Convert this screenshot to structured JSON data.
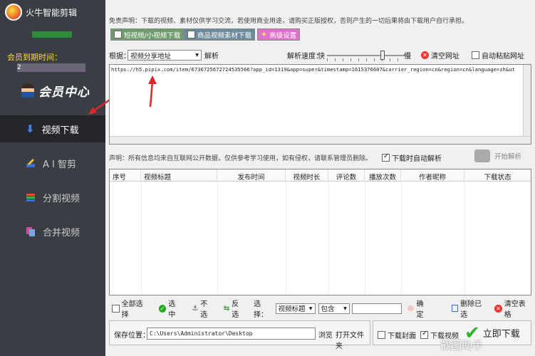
{
  "app": {
    "title": "火牛智能剪辑"
  },
  "sidebar": {
    "member_expiry_label": "会员到期时间：",
    "member_expiry_prefix": "2",
    "member_center_label": "会员中心",
    "items": [
      {
        "label": "视频下载",
        "icon": "arrow-down-icon",
        "active": true
      },
      {
        "label": "A I 智剪",
        "icon": "ai-edit-icon",
        "active": false
      },
      {
        "label": "分割视频",
        "icon": "split-icon",
        "active": false
      },
      {
        "label": "合并视频",
        "icon": "merge-icon",
        "active": false
      }
    ]
  },
  "notice": "免责声明：下载的视频、素材仅供学习交流，若使用商业用途，请购买正版授权，否则产生的一切后果将由下载用户自行承担。",
  "toolbar": {
    "buttons": [
      {
        "label": "短视频/小视频下载",
        "color": "#5f8f5f"
      },
      {
        "label": "商品视频素材下载",
        "color": "#5f7f8f"
      },
      {
        "label": "高级设置",
        "color": "#e26cc8"
      }
    ]
  },
  "parse_row": {
    "by_label": "根据：",
    "source_select": "视频分享地址",
    "parse_label": "解析",
    "speed_label": "解析速度：",
    "fast_label": "快",
    "slow_label": "慢",
    "clear_url_label": "清空网址",
    "auto_paste_label": "自动粘贴网址",
    "auto_paste_checked": false
  },
  "url_input": {
    "value": "https://h5.pipix.com/item/6736725672724535566?app_id=1319&app=super&timestamp=1615376607&carrier_region=cn&region=cn&language=zh&ut"
  },
  "statement": "声明：所有信息均来自互联网公开数据，仅供参考学习使用，如有侵权，请联系管理员删除。",
  "auto_parse": {
    "label": "下载时自动解析",
    "checked": true
  },
  "start_parse_label": "开始解析",
  "table": {
    "headers": [
      "序号",
      "视频标题",
      "发布时间",
      "视频时长",
      "评论数",
      "播放次数",
      "作者昵称",
      "下载状态"
    ],
    "rows": []
  },
  "bottom": {
    "select_all": "全部选择",
    "select": "选中",
    "deselect": "不选",
    "invert": "反选",
    "select_label": "选择：",
    "field_select": "视频标题",
    "match_select": "包含",
    "filter_value": "",
    "confirm": "确定",
    "delete_selected": "删除已选",
    "clear_table": "清空表格"
  },
  "save": {
    "label": "保存位置：",
    "path": "C:\\Users\\Administrator\\Desktop",
    "browse": "浏览",
    "open_folder": "打开文件夹"
  },
  "download": {
    "cover_label": "下载封面",
    "cover_checked": false,
    "video_label": "下载视频",
    "video_checked": true,
    "download_now": "立即下载"
  },
  "watermark": "截图助手"
}
